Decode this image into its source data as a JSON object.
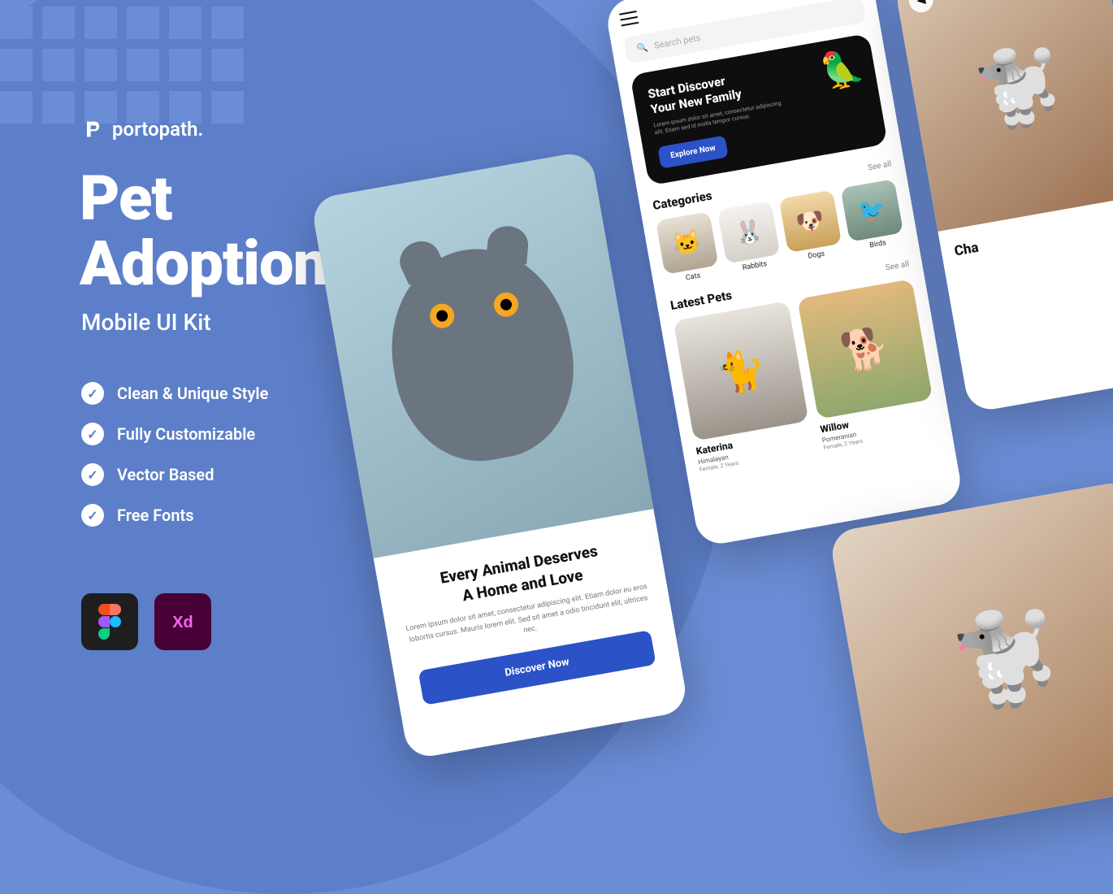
{
  "brand": {
    "name": "portopath."
  },
  "headline_line1": "Pet",
  "headline_line2": "Adoption",
  "subhead": "Mobile UI Kit",
  "features": [
    "Clean & Unique Style",
    "Fully Customizable",
    "Vector Based",
    "Free Fonts"
  ],
  "tools": [
    "Figma",
    "Adobe XD"
  ],
  "phone1": {
    "title_line1": "Every Animal Deserves",
    "title_line2": "A Home and Love",
    "desc": "Lorem ipsum dolor sit amet, consectetur adipiscing elit. Etiam dolor eu eros lobortis cursus. Mauris lorem elit. Sed sit amet a odio tincidunt elit, ultrices nec.",
    "cta": "Discover Now"
  },
  "phone2": {
    "search_placeholder": "Search pets",
    "banner": {
      "title_line1": "Start Discover",
      "title_line2": "Your New Family",
      "desc": "Lorem ipsum dolor sit amet, consectetur adipiscing elit. Etiam sed id molla tempor cursus.",
      "cta": "Explore Now"
    },
    "categories_title": "Categories",
    "see_all": "See all",
    "categories": [
      {
        "label": "Cats"
      },
      {
        "label": "Rabbits"
      },
      {
        "label": "Dogs"
      },
      {
        "label": "Birds"
      }
    ],
    "latest_title": "Latest Pets",
    "latest": [
      {
        "name": "Katerina",
        "breed": "Himalayan",
        "meta": "Female, 2 Years"
      },
      {
        "name": "Willow",
        "breed": "Pomeranian",
        "meta": "Female, 2 Years"
      }
    ]
  },
  "phone3": {
    "name_partial": "Cha"
  }
}
